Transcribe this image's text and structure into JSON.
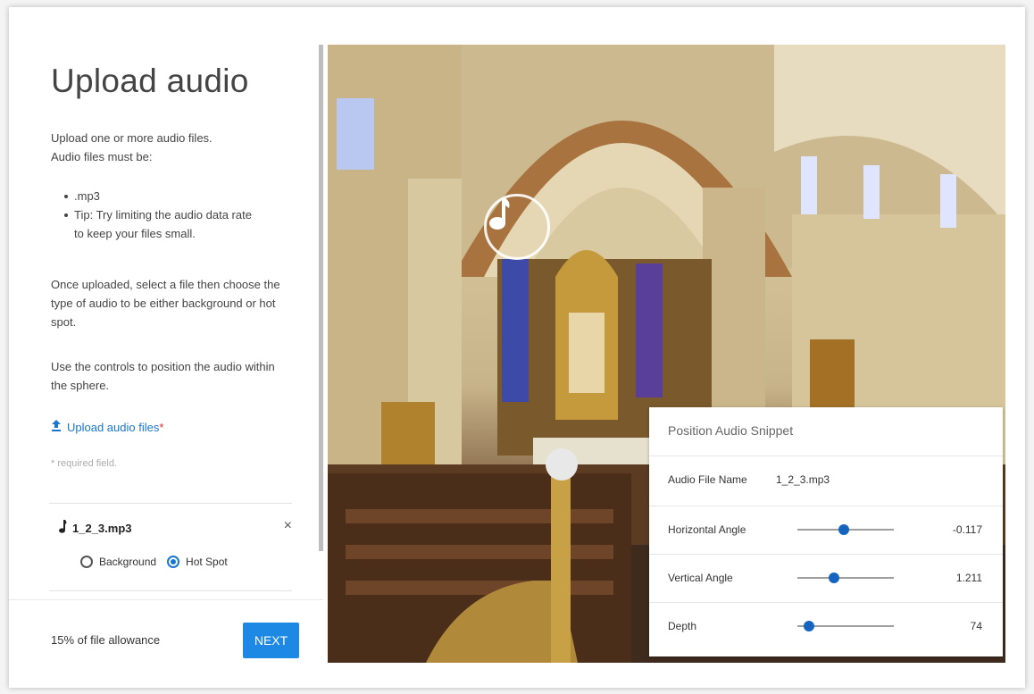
{
  "left": {
    "title": "Upload audio",
    "intro_line1": "Upload one or more audio files.",
    "intro_line2": "Audio files must be:",
    "bullets": [
      ".mp3",
      "Tip: Try limiting the audio data rate to keep your files small."
    ],
    "para_select": "Once uploaded, select a file then choose the type of audio to be either background or hot spot.",
    "para_controls": "Use the controls to position the audio within the sphere.",
    "upload_label": "Upload audio files",
    "required_mark": "*",
    "required_hint": "* required field.",
    "file": {
      "name": "1_2_3.mp3",
      "close_glyph": "×",
      "radio_options": [
        "Background",
        "Hot Spot"
      ],
      "selected": "Hot Spot"
    },
    "allowance": "15% of file allowance",
    "next_label": "NEXT"
  },
  "card": {
    "title": "Position Audio Snippet",
    "file_label": "Audio File Name",
    "file_value": "1_2_3.mp3",
    "rows": [
      {
        "label": "Horizontal Angle",
        "value": "-0.117",
        "level": 0.48
      },
      {
        "label": "Vertical Angle",
        "value": "1.211",
        "level": 0.38
      },
      {
        "label": "Depth",
        "value": "74",
        "level": 0.12
      }
    ]
  },
  "colors": {
    "accent": "#1e88e5",
    "link": "#1976d2",
    "required": "#d32f2f"
  },
  "icons": [
    "upload-icon",
    "music-note-icon",
    "close-icon",
    "radio-icon"
  ]
}
